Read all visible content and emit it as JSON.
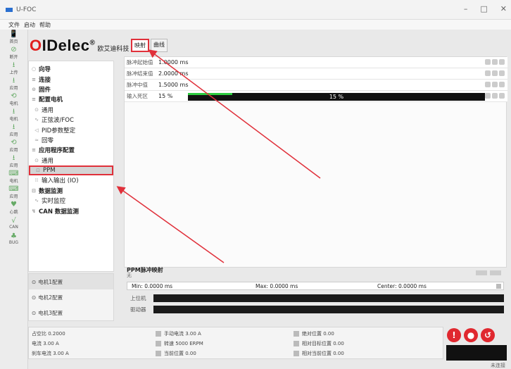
{
  "window": {
    "title": "U-FOC",
    "min": "–",
    "max": "□",
    "close": "✕"
  },
  "menu": [
    "文件",
    "启动",
    "帮助"
  ],
  "leftbar": [
    {
      "icon": "📱",
      "label": "首页"
    },
    {
      "icon": "⊘",
      "label": "断开"
    },
    {
      "icon": "⭳",
      "label": "上传"
    },
    {
      "icon": "⭳",
      "label": "应用"
    },
    {
      "icon": "⟲",
      "label": "电机"
    },
    {
      "icon": "⭳",
      "label": "电机"
    },
    {
      "icon": "⭳",
      "label": "应用"
    },
    {
      "icon": "⟲",
      "label": "应用"
    },
    {
      "icon": "⭳",
      "label": "应用"
    },
    {
      "icon": "⌨",
      "label": "电机"
    },
    {
      "icon": "⌨",
      "label": "应用"
    },
    {
      "icon": "♥",
      "label": "心跳"
    },
    {
      "icon": "√",
      "label": "CAN"
    },
    {
      "icon": "♣",
      "label": "BUG"
    }
  ],
  "logo": {
    "main": "IDelec",
    "first": "O",
    "reg": "®",
    "sub": "欧艾迪科技"
  },
  "tabs": [
    {
      "label": "映射",
      "active": true
    },
    {
      "label": "曲线",
      "active": false
    }
  ],
  "nav": [
    {
      "label": "向导",
      "type": "h",
      "icon": "○"
    },
    {
      "label": "连接",
      "type": "h",
      "icon": "≡"
    },
    {
      "label": "固件",
      "type": "h",
      "icon": "⊙"
    },
    {
      "label": "配置电机",
      "type": "h",
      "icon": "≡"
    },
    {
      "label": "通用",
      "type": "sub",
      "icon": "⊙"
    },
    {
      "label": "正弦波/FOC",
      "type": "sub",
      "icon": "∿"
    },
    {
      "label": "PID参数整定",
      "type": "sub",
      "icon": "◁"
    },
    {
      "label": "回零",
      "type": "sub",
      "icon": "≈"
    },
    {
      "label": "应用程序配置",
      "type": "h",
      "icon": "≡"
    },
    {
      "label": "通用",
      "type": "sub",
      "icon": "⊙"
    },
    {
      "label": "PPM",
      "type": "sub",
      "icon": "⊡",
      "selected": true
    },
    {
      "label": "输入输出 (IO)",
      "type": "sub",
      "icon": "⁞⁞"
    },
    {
      "label": "数据监测",
      "type": "h",
      "icon": "⊟"
    },
    {
      "label": "实时监控",
      "type": "sub",
      "icon": "∿"
    },
    {
      "label": "CAN 数据监测",
      "type": "h",
      "icon": "↯"
    }
  ],
  "motors": [
    "电机1配置",
    "电机2配置",
    "电机3配置"
  ],
  "params": [
    {
      "label": "脉冲起始值",
      "value": "1.0000 ms"
    },
    {
      "label": "脉冲结束值",
      "value": "2.0000 ms"
    },
    {
      "label": "脉冲中值",
      "value": "1.5000 ms"
    },
    {
      "label": "输入死区",
      "value": "15 %"
    }
  ],
  "deadzone_progress": {
    "text": "15 %",
    "fraction": 0.15
  },
  "ppm": {
    "title": "PPM脉冲映射",
    "subtitle": "无",
    "min": "Min: 0.0000 ms",
    "max": "Max: 0.0000 ms",
    "center": "Center: 0.0000 ms",
    "bar1": "上位机",
    "bar2": "驱动器"
  },
  "stats": [
    {
      "text": "占空比 0.2000"
    },
    {
      "text": "电流 3.00 A"
    },
    {
      "text": "刹车电流 3.00 A"
    },
    {
      "text": "手动电流 3.00 A"
    },
    {
      "text": "转速 5000 ERPM"
    },
    {
      "text": "当前位置 0.00"
    },
    {
      "text": "绝对位置 0.00"
    },
    {
      "text": "相对目标位置 0.00"
    },
    {
      "text": "相对当前位置 0.00"
    }
  ],
  "actions": [
    "!",
    "●",
    "↺"
  ],
  "status": "未连接"
}
